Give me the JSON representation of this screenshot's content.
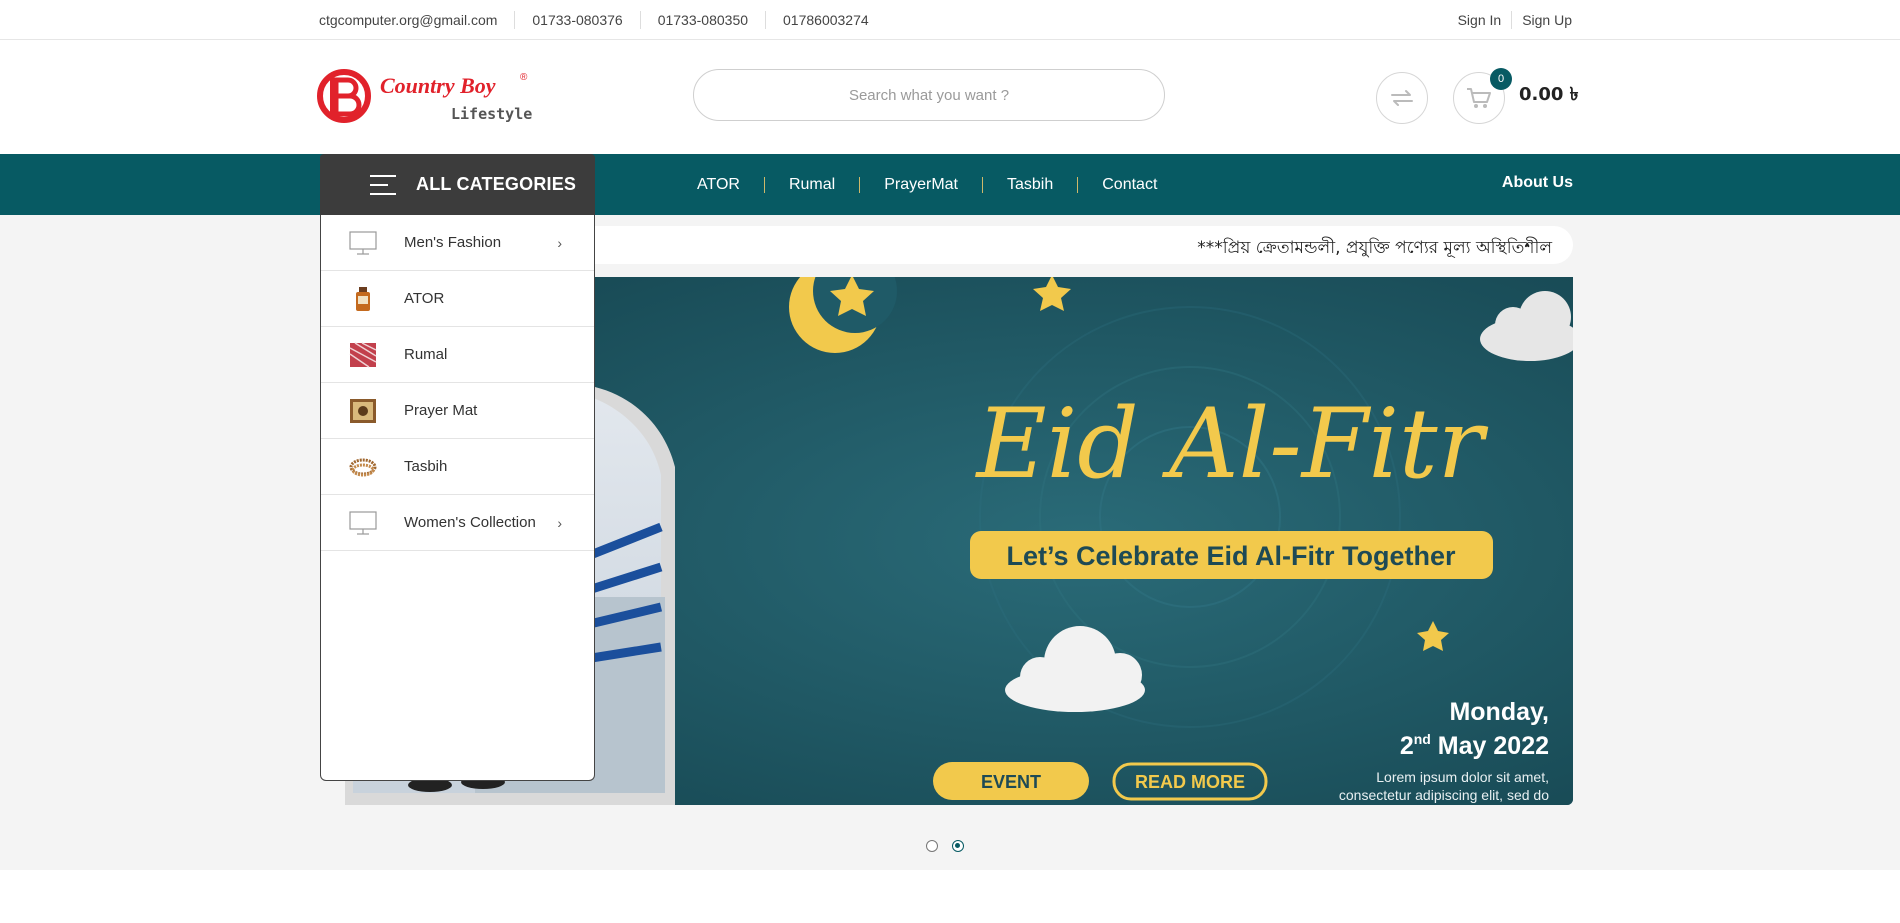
{
  "topbar": {
    "email": "ctgcomputer.org@gmail.com",
    "phones": [
      "01733-080376",
      "01733-080350",
      "01786003274"
    ],
    "sign_in": "Sign In",
    "sign_up": "Sign Up"
  },
  "brand": {
    "name": "Country Boy",
    "tagline": "Lifestyle",
    "mark": "®",
    "colors": {
      "red": "#e1222b",
      "teal": "#075a63"
    }
  },
  "search": {
    "placeholder": "Search what you want ?"
  },
  "cart": {
    "count": "0",
    "total": "0.00 ৳"
  },
  "nav": {
    "all_categories": "ALL CATEGORIES",
    "links": [
      "ATOR",
      "Rumal",
      "PrayerMat",
      "Tasbih",
      "Contact"
    ],
    "about": "About Us"
  },
  "categories": [
    {
      "label": "Men's Fashion",
      "icon": "monitor-icon",
      "has_submenu": true
    },
    {
      "label": "ATOR",
      "icon": "perfume-bottle-icon",
      "has_submenu": false
    },
    {
      "label": "Rumal",
      "icon": "scarf-icon",
      "has_submenu": false
    },
    {
      "label": "Prayer Mat",
      "icon": "prayer-mat-icon",
      "has_submenu": false
    },
    {
      "label": "Tasbih",
      "icon": "prayer-beads-icon",
      "has_submenu": false
    },
    {
      "label": "Women's Collection",
      "icon": "monitor-icon",
      "has_submenu": true
    }
  ],
  "notice": "***প্রিয় ক্রেতামন্ডলী, প্রযুক্তি পণ্যের মূল্য অস্থিতিশীল",
  "banner": {
    "title": "Eid Al-Fitr",
    "subtitle": "Let’s Celebrate Eid Al-Fitr Together",
    "date_line1": "Monday,",
    "date_day": "2",
    "date_suffix": "nd",
    "date_rest": " May 2022",
    "event_btn": "EVENT",
    "readmore_btn": "READ MORE",
    "lorem1": "Lorem ipsum dolor sit amet,",
    "lorem2": "consectetur adipiscing elit, sed do"
  },
  "slider": {
    "total": 2,
    "active": 2
  }
}
